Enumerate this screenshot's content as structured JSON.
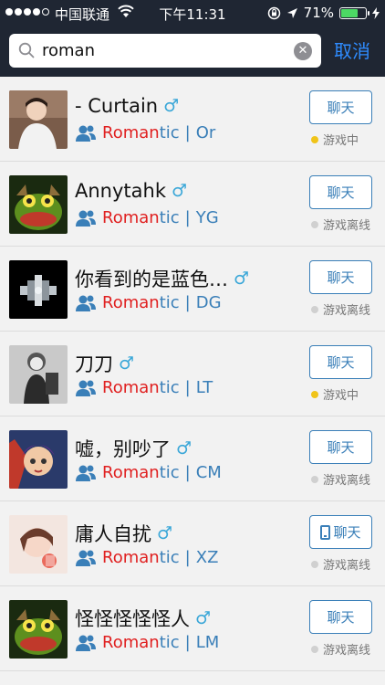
{
  "status_bar": {
    "carrier": "中国联通",
    "time": "下午11:31",
    "battery": "71%",
    "battery_level": 0.71,
    "colors": {
      "battery_fill": "#4cd964"
    }
  },
  "search": {
    "value": "roman",
    "placeholder": "",
    "cancel_label": "取消",
    "clear_icon": "clear-icon"
  },
  "colors": {
    "accent": "#2f8cff",
    "link": "#3a7fb8",
    "highlight": "#e02020",
    "online": "#f0c419",
    "offline": "#d0d0d0",
    "male": "#3aa7d8"
  },
  "results": [
    {
      "name": "- Curtain",
      "gender_icon": "male-icon",
      "gender": "♂",
      "guild_highlight": "Roman",
      "guild_rest": "tic",
      "separator": "|",
      "server": "Or",
      "chat_label": "聊天",
      "chat_has_phone_icon": false,
      "status": "游戏中",
      "online": true
    },
    {
      "name": "Annytahk",
      "gender_icon": "male-icon",
      "gender": "♂",
      "guild_highlight": "Roman",
      "guild_rest": "tic",
      "separator": "|",
      "server": "YG",
      "chat_label": "聊天",
      "chat_has_phone_icon": false,
      "status": "游戏离线",
      "online": false
    },
    {
      "name": "你看到的是蓝色…",
      "gender_icon": "male-icon",
      "gender": "♂",
      "guild_highlight": "Roman",
      "guild_rest": "tic",
      "separator": "|",
      "server": "DG",
      "chat_label": "聊天",
      "chat_has_phone_icon": false,
      "status": "游戏离线",
      "online": false
    },
    {
      "name": "刀刀",
      "gender_icon": "male-icon",
      "gender": "♂",
      "guild_highlight": "Roman",
      "guild_rest": "tic",
      "separator": "|",
      "server": "LT",
      "chat_label": "聊天",
      "chat_has_phone_icon": false,
      "status": "游戏中",
      "online": true
    },
    {
      "name": "嘘，别吵了",
      "gender_icon": "male-icon",
      "gender": "♂",
      "guild_highlight": "Roman",
      "guild_rest": "tic",
      "separator": "|",
      "server": "CM",
      "chat_label": "聊天",
      "chat_has_phone_icon": false,
      "status": "游戏离线",
      "online": false
    },
    {
      "name": "庸人自扰",
      "gender_icon": "male-icon",
      "gender": "♂",
      "guild_highlight": "Roman",
      "guild_rest": "tic",
      "separator": "|",
      "server": "XZ",
      "chat_label": "聊天",
      "chat_has_phone_icon": true,
      "status": "游戏离线",
      "online": false
    },
    {
      "name": "怪怪怪怪怪人",
      "gender_icon": "male-icon",
      "gender": "♂",
      "guild_highlight": "Roman",
      "guild_rest": "tic",
      "separator": "|",
      "server": "LM",
      "chat_label": "聊天",
      "chat_has_phone_icon": false,
      "status": "游戏离线",
      "online": false
    }
  ]
}
